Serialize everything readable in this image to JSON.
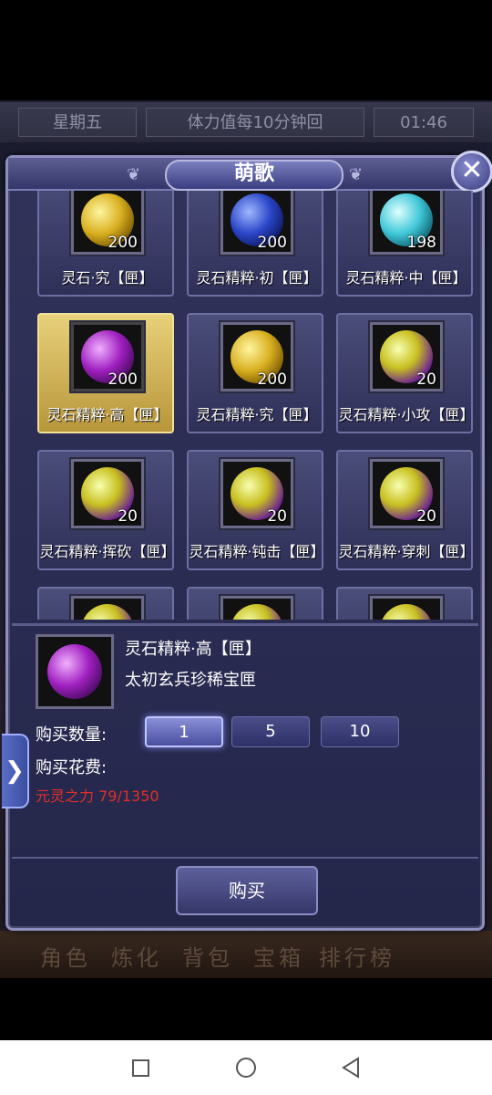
{
  "background": {
    "day": "星期五",
    "stamina": "体力值每10分钟回",
    "clock": "01:46",
    "nav_labels": [
      "角色",
      "炼化",
      "背包",
      "宝箱",
      "排行榜"
    ]
  },
  "dialog": {
    "title": "萌歌",
    "close_symbol": "✕"
  },
  "items": [
    {
      "name": "灵石·究【匣】",
      "count": "200",
      "orb": "gold",
      "selected": false
    },
    {
      "name": "灵石精粹·初【匣】",
      "count": "200",
      "orb": "blue",
      "selected": false
    },
    {
      "name": "灵石精粹·中【匣】",
      "count": "198",
      "orb": "cyan",
      "selected": false
    },
    {
      "name": "灵石精粹·高【匣】",
      "count": "200",
      "orb": "purple",
      "selected": true
    },
    {
      "name": "灵石精粹·究【匣】",
      "count": "200",
      "orb": "gold",
      "selected": false
    },
    {
      "name": "灵石精粹·小攻【匣】",
      "count": "20",
      "orb": "mix",
      "selected": false
    },
    {
      "name": "灵石精粹·挥砍【匣】",
      "count": "20",
      "orb": "mix",
      "selected": false
    },
    {
      "name": "灵石精粹·钝击【匣】",
      "count": "20",
      "orb": "mix",
      "selected": false
    },
    {
      "name": "灵石精粹·穿刺【匣】",
      "count": "20",
      "orb": "mix",
      "selected": false
    },
    {
      "name": "",
      "count": "",
      "orb": "mix",
      "selected": false
    },
    {
      "name": "",
      "count": "",
      "orb": "mix",
      "selected": false
    },
    {
      "name": "",
      "count": "",
      "orb": "mix",
      "selected": false
    }
  ],
  "detail": {
    "name": "灵石精粹·高【匣】",
    "description": "太初玄兵珍稀宝匣",
    "quantity_label": "购买数量:",
    "quantity_options": [
      "1",
      "5",
      "10"
    ],
    "selected_quantity": "1",
    "cost_label": "购买花费:",
    "cost_value": "元灵之力  79/1350",
    "buy_label": "购买"
  },
  "side_tab_symbol": "❯",
  "colors": {
    "selected_card": "#e8d07a",
    "cost_text": "#e0302a",
    "dialog_bg": "#2b2d52"
  }
}
